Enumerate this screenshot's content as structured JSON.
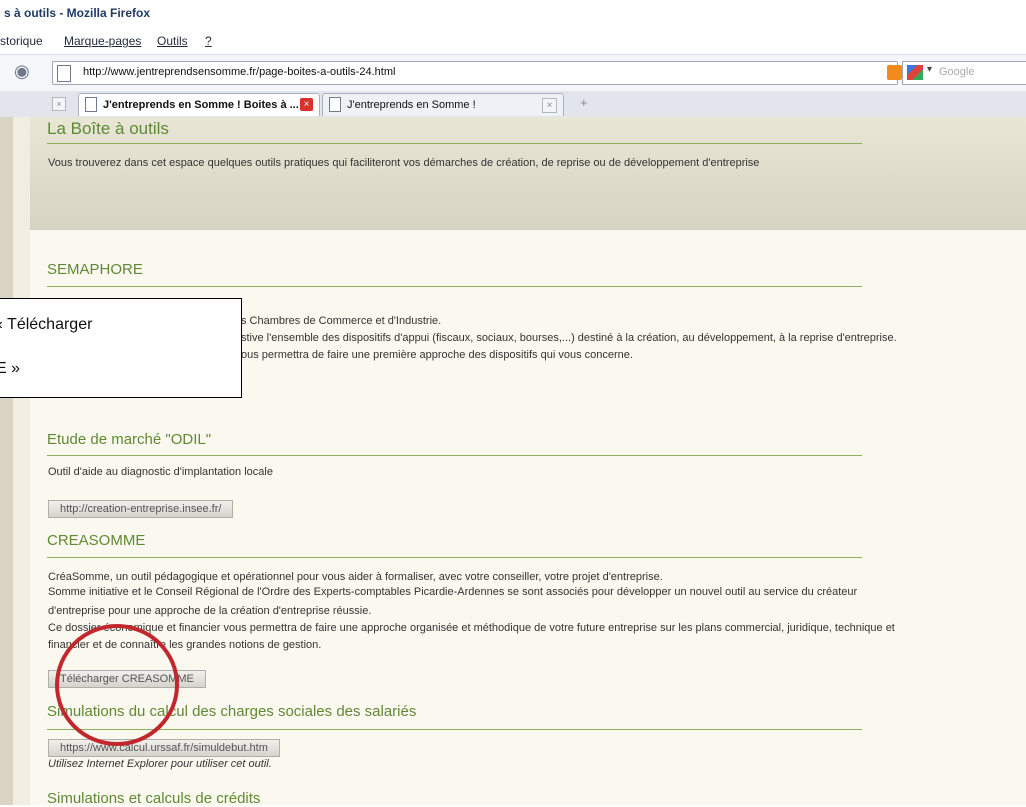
{
  "window": {
    "title": "s à outils - Mozilla Firefox"
  },
  "menu": {
    "items": [
      "storique",
      "Marque-pages",
      "Outils",
      "?"
    ]
  },
  "navbar": {
    "url": "http://www.jentreprendsensomme.fr/page-boites-a-outils-24.html",
    "search_placeholder": "Google"
  },
  "tabs": [
    {
      "label": "J'entreprends en Somme ! Boites à ...",
      "active": true
    },
    {
      "label": "J'entreprends en Somme !",
      "active": false
    }
  ],
  "page": {
    "title": "La Boîte à outils",
    "intro": "Vous trouverez dans cet espace quelques outils pratiques qui faciliteront vos démarches de création, de reprise ou de développement d'entreprise",
    "sections": [
      {
        "title": "SEMAPHORE",
        "lines": [
          "s Chambres de Commerce et d'Industrie.",
          "stive l'ensemble des dispositifs d'appui (fiscaux, sociaux, bourses,...) destiné à la création, au développement, à la reprise d'entreprise.",
          "ous permettra de faire une première approche des dispositifs qui vous concerne."
        ]
      },
      {
        "title": "Etude de marché \"ODIL\"",
        "lines": [
          "Outil d'aide au diagnostic d'implantation locale"
        ],
        "button": "http://creation-entreprise.insee.fr/"
      },
      {
        "title": "CREASOMME",
        "lines": [
          "CréaSomme, un outil pédagogique et opérationnel pour vous aider à formaliser, avec votre conseiller, votre projet d'entreprise.",
          "Somme initiative et le Conseil Régional de l'Ordre des Experts-comptables Picardie-Ardennes se sont associés pour développer un nouvel outil au service du créateur",
          "d'entreprise pour une approche de la création d'entreprise réussie.",
          "Ce dossier économique et financier vous permettra de faire une approche organisée et méthodique de votre future entreprise sur les plans commercial, juridique, technique et",
          "financier et de connaître les grandes notions de gestion."
        ],
        "button": "Télécharger CREASOMME"
      },
      {
        "title": "Simulations du calcul des charges sociales des salariés",
        "button": "https://www.calcul.urssaf.fr/simuldebut.htm",
        "note": "Utilisez Internet Explorer pour utiliser cet outil."
      },
      {
        "title": "Simulations et calculs de crédits"
      }
    ]
  },
  "annotation": {
    "line1": "« Télécharger",
    "line2": "E »"
  },
  "colors": {
    "section_title": "#5e8a34",
    "highlight_circle": "#c1272d"
  }
}
